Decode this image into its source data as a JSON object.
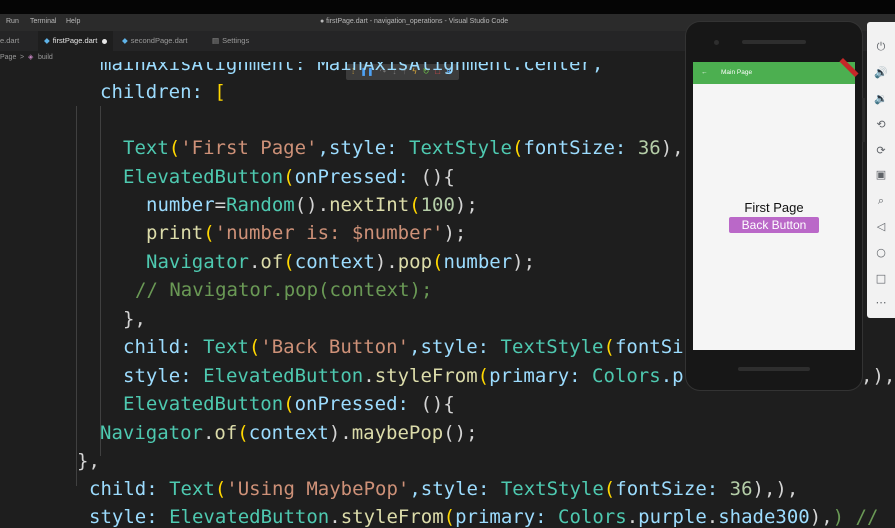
{
  "menubar": {
    "items": [
      "Run",
      "Terminal",
      "Help"
    ],
    "title": "● firstPage.dart - navigation_operations - Visual Studio Code"
  },
  "tabs": [
    {
      "label": "e.dart"
    },
    {
      "label": "firstPage.dart",
      "active": true,
      "modified": true
    },
    {
      "label": "secondPage.dart"
    },
    {
      "label": "Settings"
    }
  ],
  "debug_toolbar": {
    "icons": [
      "drag-icon",
      "pause-icon",
      "step-over-icon",
      "step-into-icon",
      "step-out-icon",
      "hot-reload-icon",
      "restart-icon",
      "stop-icon",
      "devtools-icon"
    ]
  },
  "breadcrumb": {
    "file": "Page",
    "sep": ">",
    "item": "build"
  },
  "code": {
    "l0": [
      "mainAxisAlignment: MainAxisAlignment.center,"
    ],
    "l1": [
      "children: ",
      "["
    ],
    "l3": [
      "Text",
      "(",
      "'First Page'",
      ",style: ",
      "TextStyle",
      "(",
      "fontSize: ",
      "36",
      "),"
    ],
    "l4": [
      "ElevatedButton",
      "(",
      "onPressed: ",
      "(){"
    ],
    "l5": [
      "number",
      "=",
      "Random",
      "().",
      "nextInt",
      "(",
      "100",
      ");"
    ],
    "l6": [
      "print",
      "(",
      "'number is: $number'",
      ");"
    ],
    "l7": [
      "Navigator",
      ".",
      "of",
      "(",
      "context",
      ").",
      "pop",
      "(",
      "number",
      ");"
    ],
    "l8": [
      "// Navigator.pop(context);"
    ],
    "l9": [
      "},"
    ],
    "l10": [
      "child: ",
      "Text",
      "(",
      "'Back Button'",
      ",style: ",
      "TextStyle",
      "(",
      "fontSi"
    ],
    "l11": [
      "style: ",
      "ElevatedButton",
      ".",
      "styleFrom",
      "(",
      "primary: ",
      "Colors",
      ".p",
      ",),"
    ],
    "l12": [
      "ElevatedButton",
      "(",
      "onPressed: ",
      "(){"
    ],
    "l13": [
      "Navigator",
      ".",
      "of",
      "(",
      "context",
      ").",
      "maybePop",
      "();"
    ],
    "l14": [
      "},"
    ],
    "l15": [
      "child: ",
      "Text",
      "(",
      "'Using MaybePop'",
      ",style: ",
      "TextStyle",
      "(",
      "fontSize: ",
      "36",
      "),),"
    ],
    "l16": [
      "style: ",
      "ElevatedButton",
      ".",
      "styleFrom",
      "(",
      "primary: ",
      "Colors",
      ".",
      "purple",
      ".",
      "shade300",
      "),",
      ") //"
    ]
  },
  "emulator": {
    "appbar_back": "←",
    "appbar_title": "Main Page",
    "first_page_text": "First Page",
    "back_button_label": "Back Button",
    "appbar_color": "#4caf50",
    "button_color": "#ba68c8"
  },
  "emulator_toolbar": [
    {
      "name": "power-icon",
      "glyph": "⏻"
    },
    {
      "name": "volume-up-icon",
      "glyph": "🔊"
    },
    {
      "name": "volume-down-icon",
      "glyph": "🔉"
    },
    {
      "name": "rotate-left-icon",
      "glyph": "⟲"
    },
    {
      "name": "rotate-right-icon",
      "glyph": "⟳"
    },
    {
      "name": "camera-icon",
      "glyph": "▣"
    },
    {
      "name": "zoom-icon",
      "glyph": "⌕"
    },
    {
      "name": "back-icon",
      "glyph": "◁"
    },
    {
      "name": "home-icon",
      "glyph": "○"
    },
    {
      "name": "overview-icon",
      "glyph": "□"
    },
    {
      "name": "more-icon",
      "glyph": "⋯"
    }
  ]
}
